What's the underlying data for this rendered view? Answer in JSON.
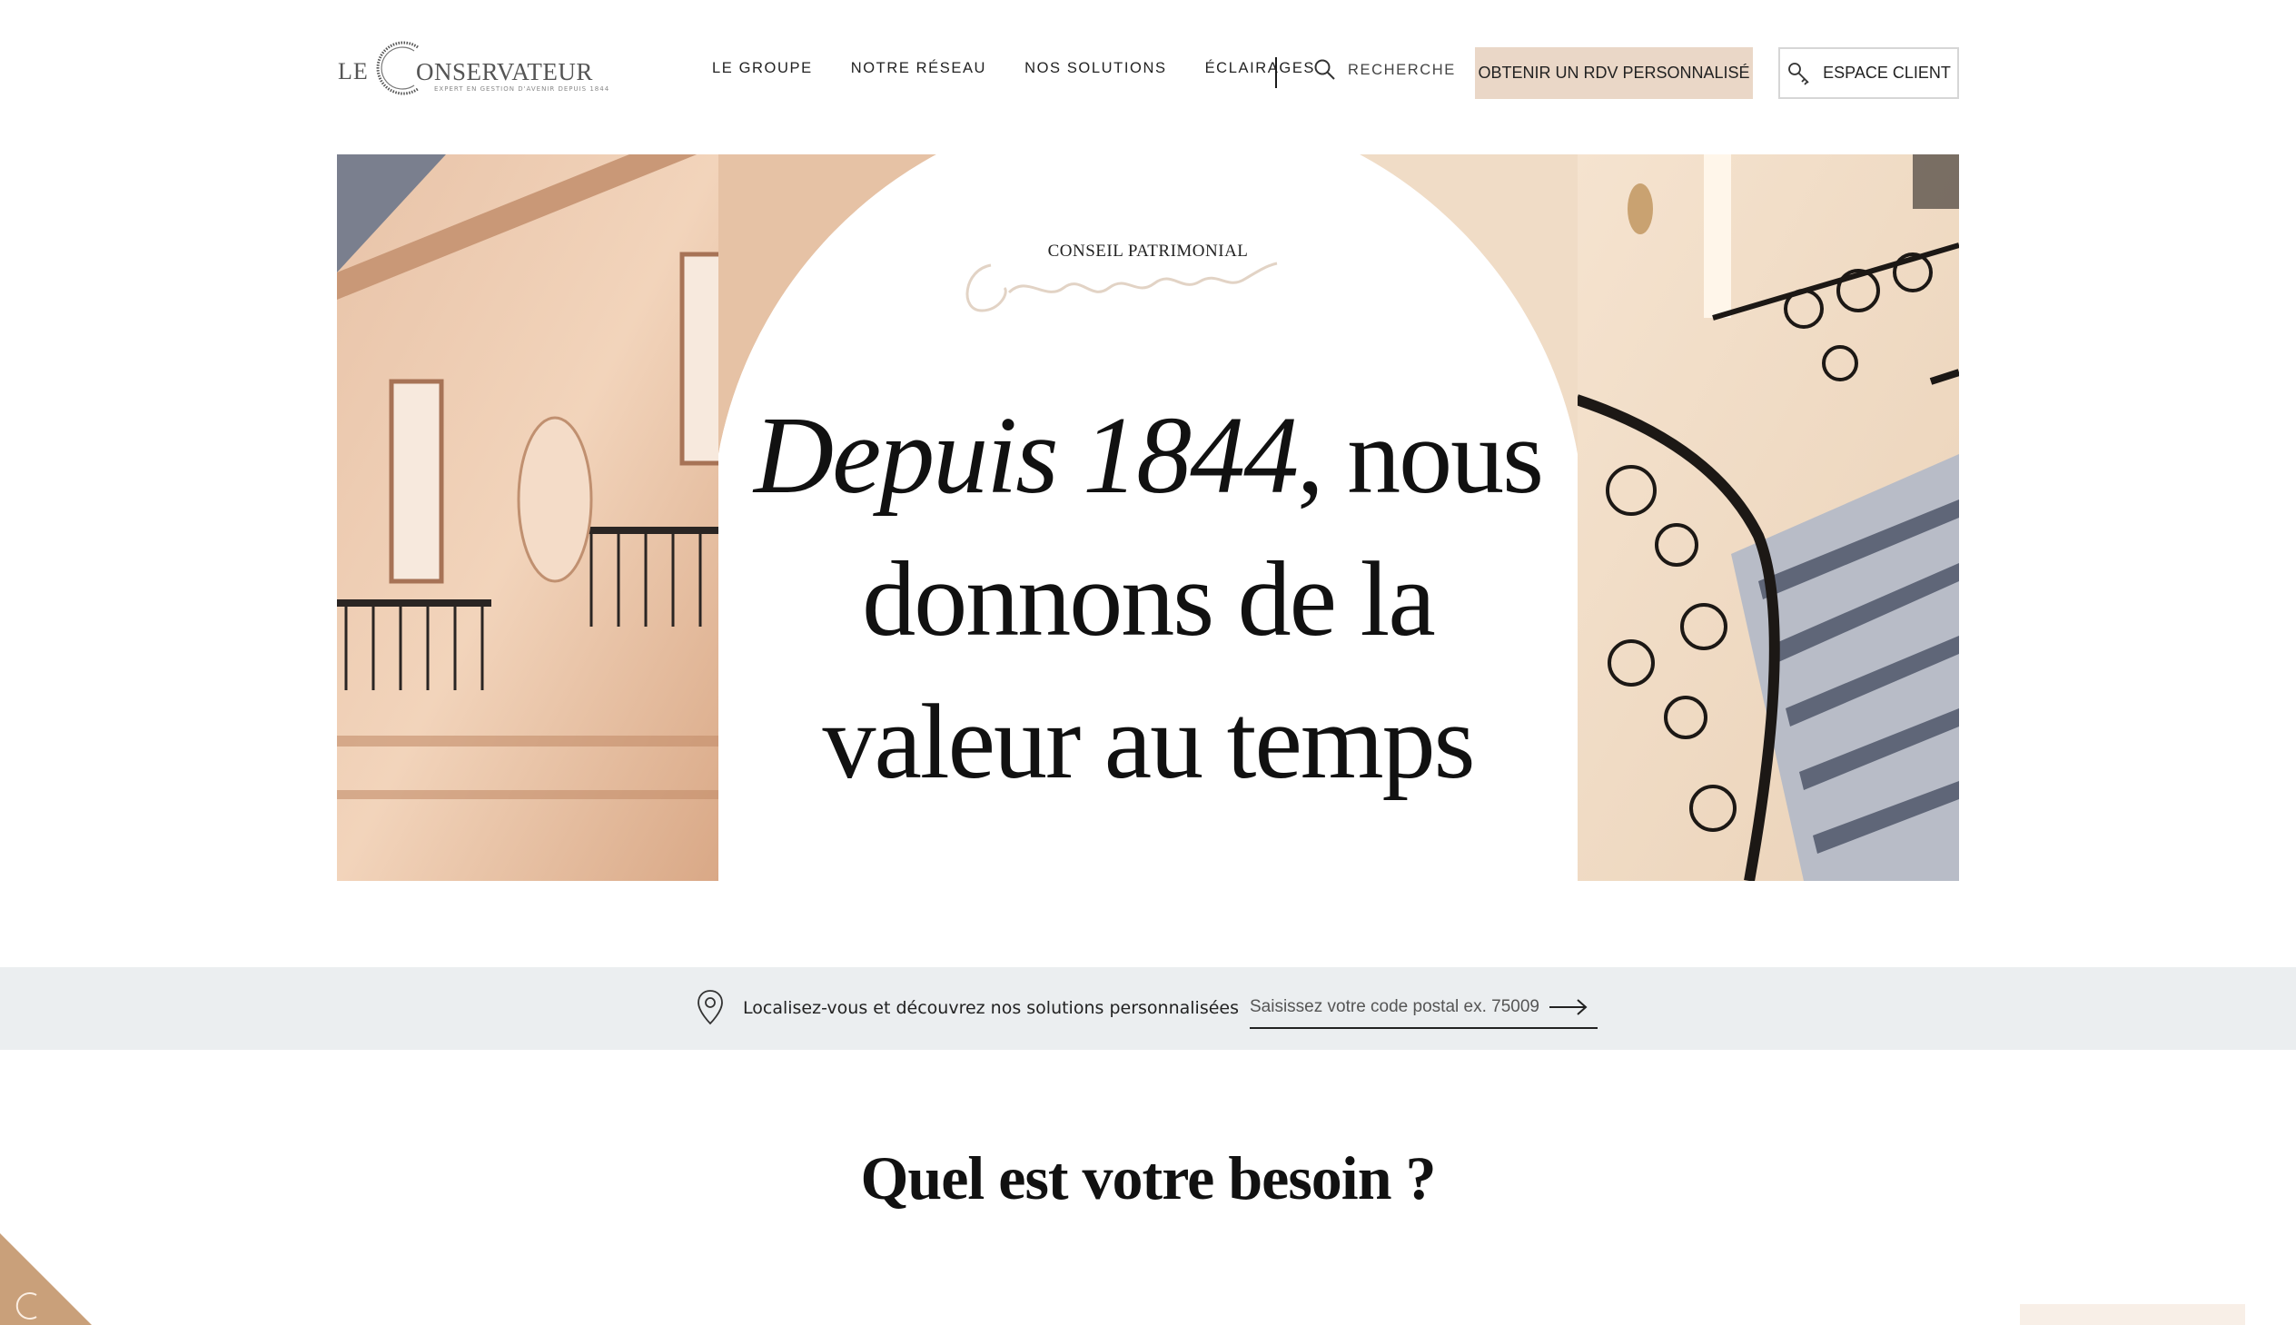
{
  "header": {
    "logo": {
      "prefix": "LE",
      "word": "ONSERVATEUR",
      "tagline": "EXPERT EN GESTION D'AVENIR DEPUIS 1844"
    },
    "nav": [
      {
        "label": "LE GROUPE"
      },
      {
        "label": "NOTRE RÉSEAU"
      },
      {
        "label": "NOS SOLUTIONS"
      },
      {
        "label": "ÉCLAIRAGES"
      }
    ],
    "search_label": "RECHERCHE",
    "rdv_label": "OBTENIR UN RDV PERSONNALISÉ",
    "client_label": "ESPACE CLIENT"
  },
  "hero": {
    "eyebrow": "CONSEIL PATRIMONIAL",
    "signature": "Conservateur",
    "headline_italic": "Depuis 1844",
    "headline_line1_rest": ", nous",
    "headline_line2": "donnons de la",
    "headline_line3": "valeur au temps"
  },
  "locator": {
    "text": "Localisez-vous et découvrez nos solutions personnalisées",
    "placeholder": "Saisissez votre code postal ex. 75009"
  },
  "needs": {
    "title": "Quel est votre besoin ?"
  },
  "colors": {
    "accent_beige": "#ead7c7",
    "locator_bg": "#ebeef0",
    "corner_badge": "#c9a07a"
  }
}
